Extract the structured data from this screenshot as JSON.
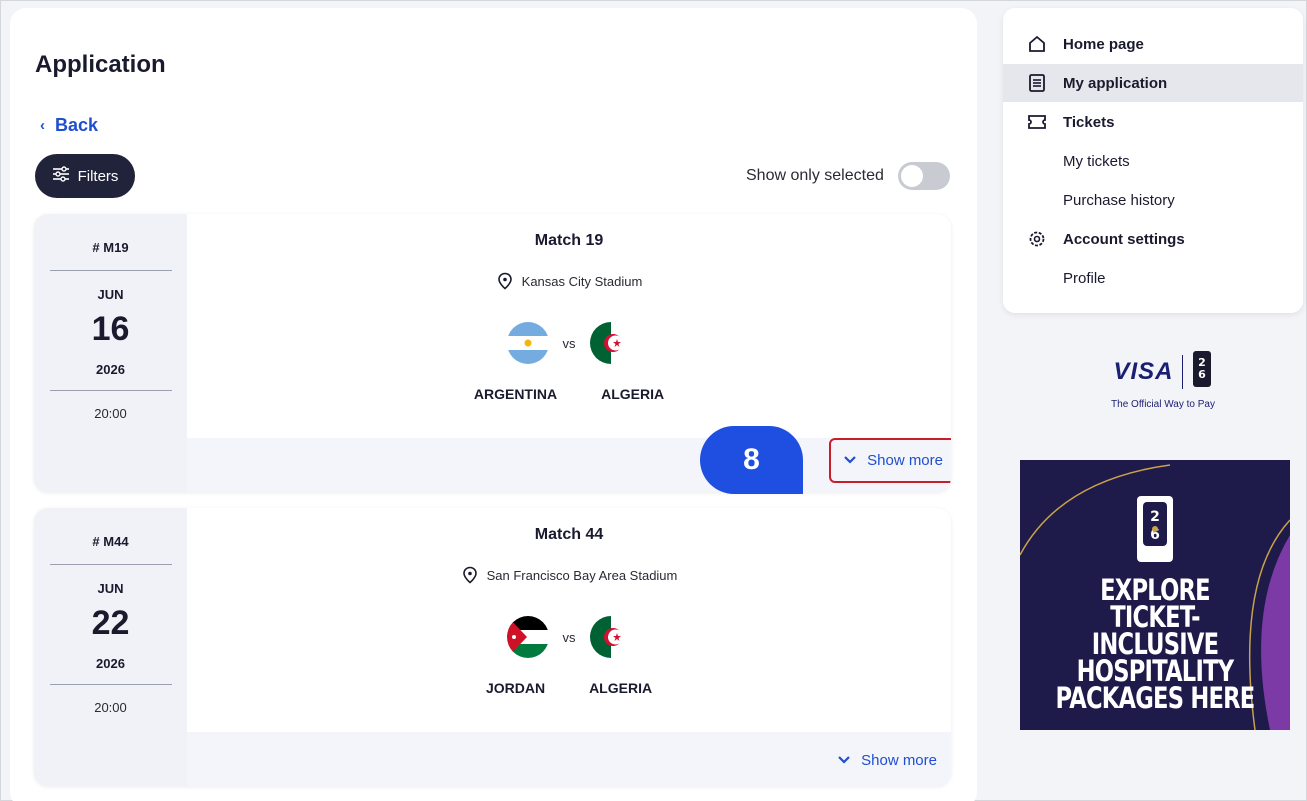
{
  "page": {
    "title": "Application",
    "back_label": "Back"
  },
  "filters": {
    "label": "Filters"
  },
  "toggle": {
    "label": "Show only selected",
    "on": false
  },
  "badge": {
    "label": "8"
  },
  "matches": [
    {
      "code": "# M19",
      "month": "JUN",
      "day": "16",
      "year": "2026",
      "time": "20:00",
      "title": "Match 19",
      "venue": "Kansas City Stadium",
      "team1": "ARGENTINA",
      "team2": "ALGERIA",
      "vs": "vs",
      "show_more": "Show more"
    },
    {
      "code": "# M44",
      "month": "JUN",
      "day": "22",
      "year": "2026",
      "time": "20:00",
      "title": "Match 44",
      "venue": "San Francisco Bay Area Stadium",
      "team1": "JORDAN",
      "team2": "ALGERIA",
      "vs": "vs",
      "show_more": "Show more"
    }
  ],
  "sidebar": {
    "items": [
      {
        "label": "Home page",
        "icon": "home-icon"
      },
      {
        "label": "My application",
        "icon": "document-icon"
      },
      {
        "label": "Tickets",
        "icon": "ticket-icon"
      },
      {
        "label": "My tickets"
      },
      {
        "label": "Purchase history"
      },
      {
        "label": "Account settings",
        "icon": "gear-icon"
      },
      {
        "label": "Profile"
      }
    ]
  },
  "visa": {
    "brand": "VISA",
    "tagline": "The Official Way to Pay"
  },
  "promo": {
    "lines": [
      "EXPLORE",
      "TICKET-INCLUSIVE",
      "HOSPITALITY",
      "PACKAGES HERE"
    ]
  },
  "colors": {
    "accent": "#1f4fd1",
    "dark": "#20233a",
    "highlight": "#c81e2b",
    "promo_bg": "#1e1a4a"
  }
}
